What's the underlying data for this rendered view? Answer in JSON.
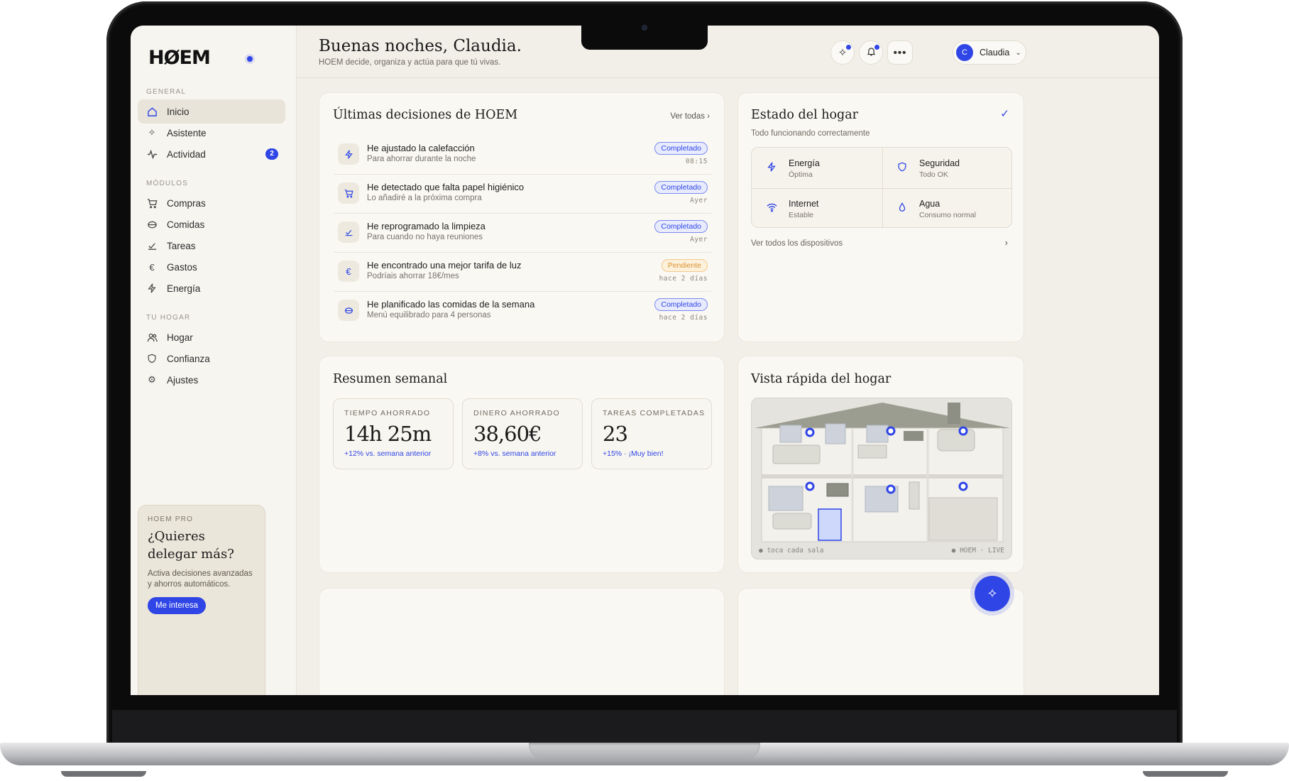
{
  "app": {
    "logo": "HØEM"
  },
  "sidebar": {
    "sections": {
      "general": "GENERAL",
      "modules": "MÓDULOS",
      "home": "TU HOGAR"
    },
    "general_items": [
      {
        "label": "Inicio",
        "icon": "home-icon",
        "active": true
      },
      {
        "label": "Asistente",
        "icon": "sparkle-icon"
      },
      {
        "label": "Actividad",
        "icon": "activity-icon",
        "badge": "2"
      }
    ],
    "module_items": [
      {
        "label": "Compras",
        "icon": "cart-icon"
      },
      {
        "label": "Comidas",
        "icon": "bowl-icon"
      },
      {
        "label": "Tareas",
        "icon": "check-icon"
      },
      {
        "label": "Gastos",
        "icon": "euro-icon"
      },
      {
        "label": "Energía",
        "icon": "bolt-icon"
      }
    ],
    "home_items": [
      {
        "label": "Hogar",
        "icon": "users-icon"
      },
      {
        "label": "Confianza",
        "icon": "shield-icon"
      },
      {
        "label": "Ajustes",
        "icon": "gear-icon"
      }
    ],
    "promo": {
      "eyebrow": "HOEM PRO",
      "title": "¿Quieres delegar más?",
      "desc": "Activa decisiones avanzadas y ahorros automáticos.",
      "cta": "Me interesa"
    }
  },
  "header": {
    "greeting": "Buenas noches, Claudia.",
    "subtitle": "HOEM decide, organiza y actúa para que tú vivas.",
    "user": {
      "initial": "C",
      "name": "Claudia"
    }
  },
  "decisions": {
    "title": "Últimas decisiones de HOEM",
    "see_all": "Ver todas ›",
    "items": [
      {
        "title": "He ajustado la calefacción",
        "sub": "Para ahorrar durante la noche",
        "status": "Completado",
        "time": "08:15",
        "icon": "bolt-icon"
      },
      {
        "title": "He detectado que falta papel higiénico",
        "sub": "Lo añadiré a la próxima compra",
        "status": "Completado",
        "time": "Ayer",
        "icon": "cart-icon"
      },
      {
        "title": "He reprogramado la limpieza",
        "sub": "Para cuando no haya reuniones",
        "status": "Completado",
        "time": "Ayer",
        "icon": "check-icon"
      },
      {
        "title": "He encontrado una mejor tarifa de luz",
        "sub": "Podríais ahorrar 18€/mes",
        "status": "Pendiente",
        "time": "hace 2 días",
        "icon": "euro-icon"
      },
      {
        "title": "He planificado las comidas de la semana",
        "sub": "Menú equilibrado para 4 personas",
        "status": "Completado",
        "time": "hace 2 días",
        "icon": "bowl-icon"
      }
    ]
  },
  "home_status": {
    "title": "Estado del hogar",
    "subtitle": "Todo funcionando correctamente",
    "cells": [
      {
        "name": "Energía",
        "value": "Óptima",
        "icon": "bolt-icon"
      },
      {
        "name": "Seguridad",
        "value": "Todo OK",
        "icon": "shield-icon"
      },
      {
        "name": "Internet",
        "value": "Estable",
        "icon": "wifi-icon"
      },
      {
        "name": "Agua",
        "value": "Consumo normal",
        "icon": "drop-icon"
      }
    ],
    "see_devices": "Ver todos los dispositivos"
  },
  "weekly": {
    "title": "Resumen semanal",
    "metrics": [
      {
        "label": "TIEMPO AHORRADO",
        "value": "14h 25m",
        "delta": "+12% vs. semana anterior"
      },
      {
        "label": "DINERO AHORRADO",
        "value": "38,60€",
        "delta": "+8% vs. semana anterior"
      },
      {
        "label": "TAREAS COMPLETADAS",
        "value": "23",
        "delta": "+15% · ¡Muy bien!"
      }
    ]
  },
  "quick_view": {
    "title": "Vista rápida del hogar",
    "hint": "● toca cada sala",
    "live": "● HOEM · LIVE"
  },
  "colors": {
    "accent": "#2f45e6",
    "bg": "#f2efe8",
    "card": "#faf8f3",
    "pending": "#d89130"
  }
}
